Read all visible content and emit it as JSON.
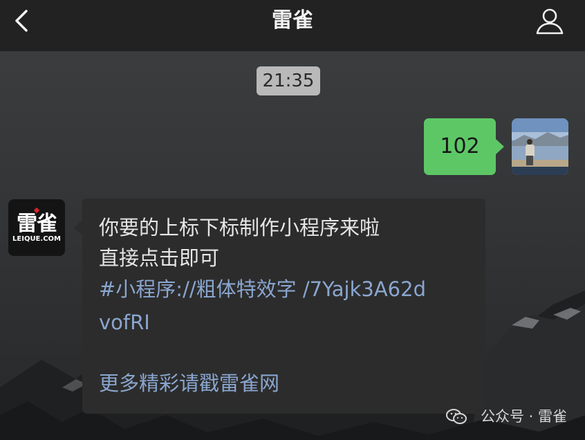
{
  "header": {
    "title": "雷雀",
    "back_icon": "chevron-left-icon",
    "profile_icon": "person-icon"
  },
  "chat": {
    "timestamp": "21:35",
    "outgoing_message": "102",
    "incoming_message": {
      "line1": "你要的上标下标制作小程序来啦",
      "line2": "直接点击即可",
      "link_line1": " #小程序://粗体特效字 /7Yajk3A62d",
      "link_line2": "vofRI",
      "footer_link": "更多精彩请戳雷雀网"
    },
    "bot_avatar": {
      "logo_text": "雷雀",
      "logo_domain": "LEIQUE.COM"
    }
  },
  "watermark": {
    "text": "公众号 · 雷雀",
    "icon": "wechat-icon"
  },
  "colors": {
    "header_bg": "#222222",
    "outgoing_bubble": "#5dc766",
    "incoming_bubble": "#2c2c2c",
    "link": "#8aa6cf",
    "logo_accent": "#d8232a"
  }
}
